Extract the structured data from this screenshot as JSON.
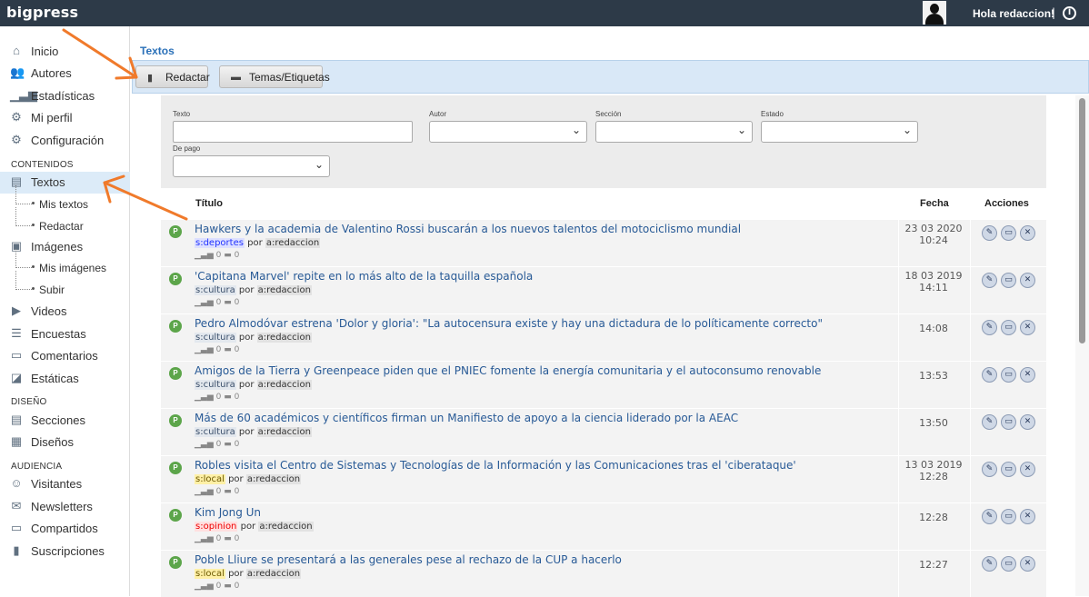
{
  "app": {
    "name": "bigpress"
  },
  "user": {
    "greeting": "Hola redaccion!",
    "separator": "|"
  },
  "sidebar": {
    "items": [
      {
        "label": "Inicio",
        "icon": "home-icon",
        "glyph": "⌂"
      },
      {
        "label": "Autores",
        "icon": "users-icon",
        "glyph": "👥"
      },
      {
        "label": "Estadísticas",
        "icon": "chart-icon",
        "glyph": "▁▃▆"
      },
      {
        "label": "Mi perfil",
        "icon": "gears-icon",
        "glyph": "⚙"
      },
      {
        "label": "Configuración",
        "icon": "gear-icon",
        "glyph": "⚙"
      }
    ],
    "section_contenidos": "CONTENIDOS",
    "contenidos": [
      {
        "label": "Textos",
        "icon": "document-icon",
        "glyph": "▤",
        "active": true
      },
      {
        "label": "Mis textos",
        "sub": true
      },
      {
        "label": "Redactar",
        "sub": true
      },
      {
        "label": "Imágenes",
        "icon": "image-icon",
        "glyph": "▣"
      },
      {
        "label": "Mis imágenes",
        "sub": true
      },
      {
        "label": "Subir",
        "sub": true
      },
      {
        "label": "Videos",
        "icon": "video-icon",
        "glyph": "▶"
      },
      {
        "label": "Encuestas",
        "icon": "poll-icon",
        "glyph": "☰"
      },
      {
        "label": "Comentarios",
        "icon": "comment-icon",
        "glyph": "▭"
      },
      {
        "label": "Estáticas",
        "icon": "static-page-icon",
        "glyph": "◪"
      }
    ],
    "section_diseno": "DISEÑO",
    "diseno": [
      {
        "label": "Secciones",
        "icon": "sections-icon",
        "glyph": "▤"
      },
      {
        "label": "Diseños",
        "icon": "layout-icon",
        "glyph": "▦"
      }
    ],
    "section_audiencia": "AUDIENCIA",
    "audiencia": [
      {
        "label": "Visitantes",
        "icon": "visitors-icon",
        "glyph": "☺"
      },
      {
        "label": "Newsletters",
        "icon": "newsletter-icon",
        "glyph": "✉"
      },
      {
        "label": "Compartidos",
        "icon": "share-icon",
        "glyph": "▭"
      },
      {
        "label": "Suscripciones",
        "icon": "subscription-icon",
        "glyph": "▮"
      }
    ]
  },
  "main": {
    "title": "Textos",
    "toolbar": {
      "redactar": "Redactar",
      "temas": "Temas/Etiquetas"
    },
    "filters": {
      "texto_label": "Texto",
      "autor_label": "Autor",
      "seccion_label": "Sección",
      "estado_label": "Estado",
      "pago_label": "De pago"
    },
    "table": {
      "col_title": "Título",
      "col_date": "Fecha",
      "col_actions": "Acciones",
      "rows": [
        {
          "badge": "P",
          "title": "Hawkers y la academia de Valentino Rossi buscarán a los nuevos talentos del motociclismo mundial",
          "section": "s:deportes",
          "section_key": "deportes",
          "por": "por",
          "author": "a:redaccion",
          "visits": "0",
          "comments": "0",
          "date": "23 03 2020",
          "time": "10:24"
        },
        {
          "badge": "P",
          "title": "'Capitana Marvel' repite en lo más alto de la taquilla española",
          "section": "s:cultura",
          "section_key": "cultura",
          "por": "por",
          "author": "a:redaccion",
          "visits": "0",
          "comments": "0",
          "date": "18 03 2019",
          "time": "14:11"
        },
        {
          "badge": "P",
          "title": "Pedro Almodóvar estrena 'Dolor y gloria': \"La autocensura existe y hay una dictadura de lo políticamente correcto\"",
          "section": "s:cultura",
          "section_key": "cultura",
          "por": "por",
          "author": "a:redaccion",
          "visits": "0",
          "comments": "0",
          "date": "",
          "time": "14:08"
        },
        {
          "badge": "P",
          "title": "Amigos de la Tierra y Greenpeace piden que el PNIEC fomente la energía comunitaria y el autoconsumo renovable",
          "section": "s:cultura",
          "section_key": "cultura",
          "por": "por",
          "author": "a:redaccion",
          "visits": "0",
          "comments": "0",
          "date": "",
          "time": "13:53"
        },
        {
          "badge": "P",
          "title": "Más de 60 académicos y científicos firman un Manifiesto de apoyo a la ciencia liderado por la AEAC",
          "section": "s:cultura",
          "section_key": "cultura",
          "por": "por",
          "author": "a:redaccion",
          "visits": "0",
          "comments": "0",
          "date": "",
          "time": "13:50"
        },
        {
          "badge": "P",
          "title": "Robles visita el Centro de Sistemas y Tecnologías de la Información y las Comunicaciones tras el 'ciberataque'",
          "section": "s:local",
          "section_key": "local",
          "por": "por",
          "author": "a:redaccion",
          "visits": "0",
          "comments": "0",
          "date": "13 03 2019",
          "time": "12:28"
        },
        {
          "badge": "P",
          "title": "Kim Jong Un",
          "section": "s:opinion",
          "section_key": "opinion",
          "por": "por",
          "author": "a:redaccion",
          "visits": "0",
          "comments": "0",
          "date": "",
          "time": "12:28"
        },
        {
          "badge": "P",
          "title": "Poble Lliure se presentará a las generales pese al rechazo de la CUP a hacerlo",
          "section": "s:local",
          "section_key": "local",
          "por": "por",
          "author": "a:redaccion",
          "visits": "0",
          "comments": "0",
          "date": "",
          "time": "12:27"
        }
      ]
    }
  },
  "colors": {
    "topbar": "#2d3a48",
    "accent": "#2a70b8",
    "toolbar": "#d9e8f7",
    "arrow": "#f07a2b",
    "published": "#5ca54a"
  }
}
